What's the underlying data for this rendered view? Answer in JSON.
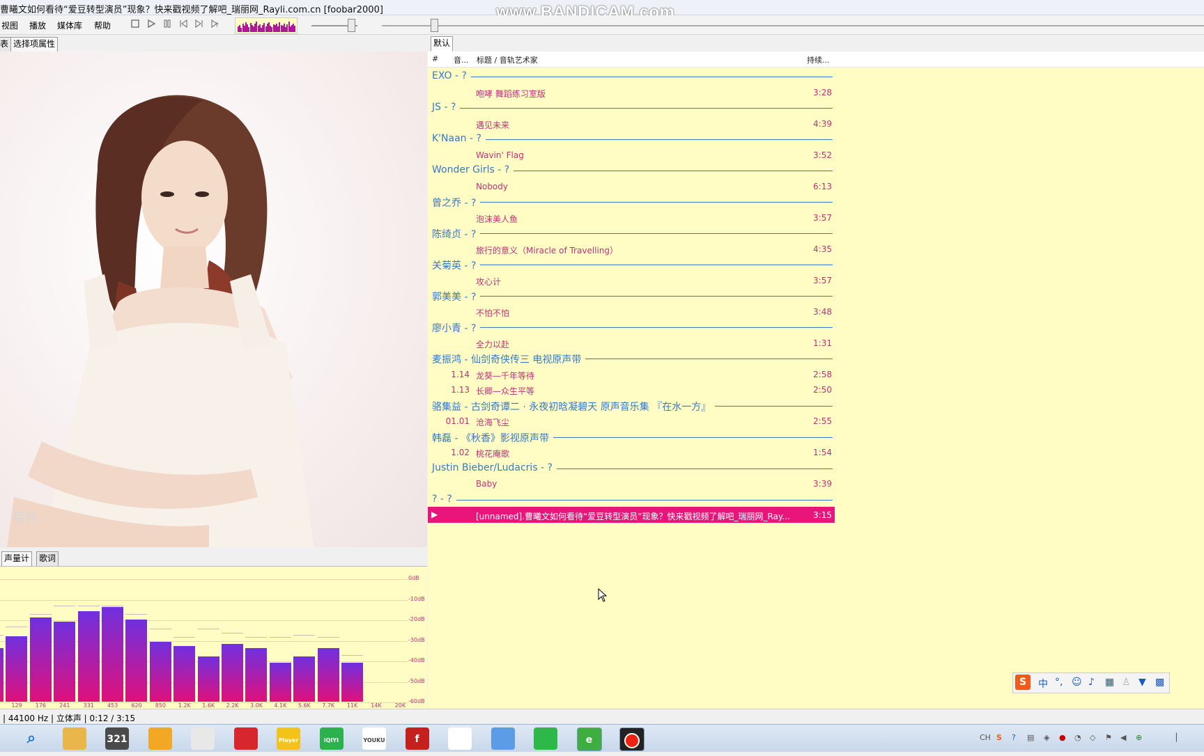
{
  "window": {
    "title": "曹曦文如何看待“爱豆转型演员”现象？快来戳视频了解吧_瑞丽网_Rayli.com.cn  [foobar2000]",
    "watermark": "www.BANDICAM.com"
  },
  "menu": [
    "视图",
    "播放",
    "媒体库",
    "帮助"
  ],
  "toolbar": {
    "buttons": [
      "stop-icon",
      "play-icon",
      "pause-icon",
      "previous-icon",
      "next-icon",
      "random-icon"
    ],
    "volume_level": 0.85,
    "seek_position": 0.063
  },
  "left_panel": {
    "tabs": [
      "表",
      "选择项属性"
    ],
    "album_art_caption": "百科",
    "bottom_tabs": [
      "声量计",
      "歌词"
    ]
  },
  "spectrum": {
    "db_labels": [
      "0dB",
      "-10dB",
      "-20dB",
      "-30dB",
      "-40dB",
      "-50dB",
      "-60dB"
    ],
    "freq_labels": [
      "129",
      "176",
      "241",
      "331",
      "453",
      "620",
      "850",
      "1.2K",
      "1.6K",
      "2.2K",
      "3.0K",
      "4.1K",
      "5.6K",
      "7.7K",
      "11K",
      "14K",
      "20K"
    ],
    "bars": [
      -34,
      -28,
      -19,
      -21,
      -16,
      -14,
      -20,
      -31,
      -33,
      -38,
      -32,
      -34,
      -41,
      -38,
      -34,
      -41
    ],
    "peaks": [
      -27,
      -23,
      -17,
      -13,
      -13,
      -13,
      -17,
      -24,
      -28,
      -24,
      -26,
      -28,
      -28,
      -27,
      -28,
      -37
    ]
  },
  "status": {
    "text": "| 44100 Hz | 立体声 | 0:12 / 3:15"
  },
  "playlist": {
    "tab": "默认",
    "columns": {
      "number": "#",
      "track": "音...",
      "title": "标题 / 音轨艺术家",
      "duration": "持续..."
    },
    "groups": [
      {
        "header": "EXO - ?",
        "tracks": [
          {
            "num": "",
            "title": "咆哮 舞蹈练习室版",
            "dur": "3:28"
          }
        ]
      },
      {
        "header": "JS - ?",
        "tracks": [
          {
            "num": "",
            "title": "遇见未来",
            "dur": "4:39"
          }
        ]
      },
      {
        "header": "K'Naan - ?",
        "tracks": [
          {
            "num": "",
            "title": "Wavin' Flag",
            "dur": "3:52"
          }
        ]
      },
      {
        "header": "Wonder Girls - ?",
        "tracks": [
          {
            "num": "",
            "title": "Nobody",
            "dur": "6:13"
          }
        ]
      },
      {
        "header": "曾之乔 - ?",
        "tracks": [
          {
            "num": "",
            "title": "泡沫美人鱼",
            "dur": "3:57"
          }
        ]
      },
      {
        "header": "陈绮贞 - ?",
        "tracks": [
          {
            "num": "",
            "title": "旅行的意义（Miracle of Travelling）",
            "dur": "4:35"
          }
        ]
      },
      {
        "header": "关菊英 - ?",
        "tracks": [
          {
            "num": "",
            "title": "攻心计",
            "dur": "3:57"
          }
        ]
      },
      {
        "header": "郭美美 - ?",
        "tracks": [
          {
            "num": "",
            "title": "不怕不怕",
            "dur": "3:48"
          }
        ]
      },
      {
        "header": "廖小青 - ?",
        "tracks": [
          {
            "num": "",
            "title": "全力以赴",
            "dur": "1:31"
          }
        ]
      },
      {
        "header": "麦振鸿 - 仙剑奇侠传三 电视原声带",
        "tracks": [
          {
            "num": "1.14",
            "title": "龙葵—千年等待",
            "dur": "2:58"
          },
          {
            "num": "1.13",
            "title": "长卿—众生平等",
            "dur": "2:50"
          }
        ]
      },
      {
        "header": "骆集益 - 古剑奇谭二 · 永夜初晗凝碧天 原声音乐集 『在水一方』",
        "tracks": [
          {
            "num": "01.01",
            "title": "沧海飞尘",
            "dur": "2:55"
          }
        ]
      },
      {
        "header": "韩磊 - 《秋香》影视原声带",
        "tracks": [
          {
            "num": "1.02",
            "title": "桃花庵歌",
            "dur": "1:54"
          }
        ]
      },
      {
        "header": "Justin Bieber/Ludacris - ?",
        "tracks": [
          {
            "num": "",
            "title": "Baby",
            "dur": "3:39"
          }
        ]
      },
      {
        "header": "? - ?",
        "tracks": [
          {
            "num": "",
            "title": "[unnamed].曹曦文如何看待“爱豆转型演员”现象？快来戳视频了解吧_瑞丽网_Ray...",
            "dur": "3:15",
            "playing": true
          }
        ]
      }
    ]
  },
  "ime": {
    "items": [
      "sogou-logo-icon",
      "中",
      "°,",
      "emoji-icon",
      "microphone-icon",
      "keyboard-icon",
      "user-icon",
      "shirt-icon",
      "grid-icon"
    ]
  },
  "taskbar": {
    "apps": [
      {
        "name": "search",
        "label": "",
        "color": "#1f7bd0"
      },
      {
        "name": "file-explorer",
        "label": "",
        "color": "#e8b64a"
      },
      {
        "name": "321-player",
        "label": "321",
        "color": "#4a4a4a"
      },
      {
        "name": "headphones",
        "label": "",
        "color": "#f3a825"
      },
      {
        "name": "alien-app",
        "label": "",
        "color": "#e8e8e8"
      },
      {
        "name": "netease-music",
        "label": "",
        "color": "#d8262f"
      },
      {
        "name": "player",
        "label": "Player",
        "color": "#f3c21b"
      },
      {
        "name": "iqiyi",
        "label": "iQIYI",
        "color": "#2bb24c"
      },
      {
        "name": "youku",
        "label": "YOUKU",
        "color": "#ffffff"
      },
      {
        "name": "flash",
        "label": "f",
        "color": "#c4201d"
      },
      {
        "name": "chrome",
        "label": "",
        "color": "#ffffff"
      },
      {
        "name": "feiq",
        "label": "",
        "color": "#5c9ce6"
      },
      {
        "name": "media-player",
        "label": "",
        "color": "#2fb84a"
      },
      {
        "name": "browser",
        "label": "e",
        "color": "#3dae3f"
      },
      {
        "name": "bandicam",
        "label": "",
        "color": "#222222"
      }
    ],
    "tray_text": "CH"
  }
}
